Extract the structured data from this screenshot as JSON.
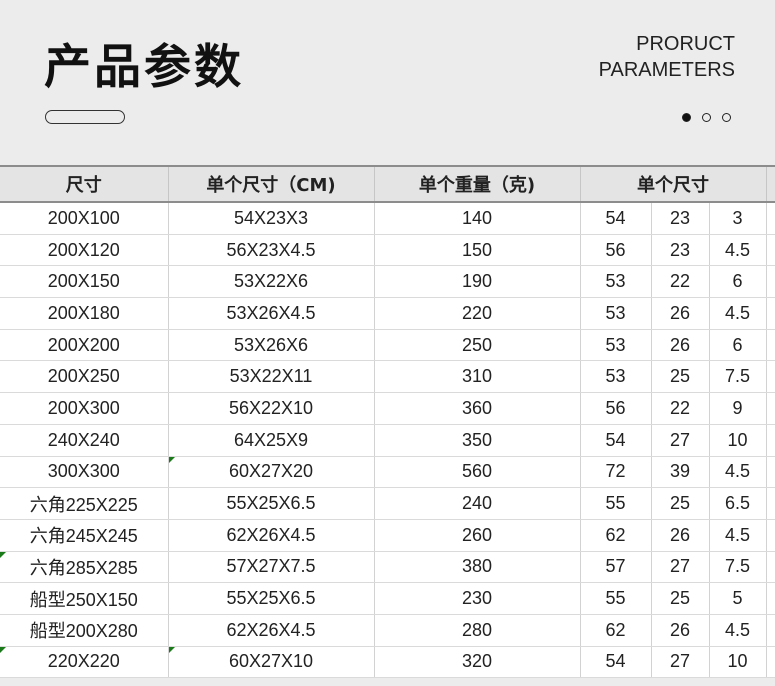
{
  "header": {
    "title": "产品参数",
    "subtitle_line1": "PRORUCT",
    "subtitle_line2": "PARAMETERS"
  },
  "table": {
    "headers": [
      "尺寸",
      "单个尺寸（CM)",
      "单个重量（克)",
      "单个尺寸"
    ],
    "rows": [
      [
        "200X100",
        "54X23X3",
        "140",
        "54",
        "23",
        "3"
      ],
      [
        "200X120",
        "56X23X4.5",
        "150",
        "56",
        "23",
        "4.5"
      ],
      [
        "200X150",
        "53X22X6",
        "190",
        "53",
        "22",
        "6"
      ],
      [
        "200X180",
        "53X26X4.5",
        "220",
        "53",
        "26",
        "4.5"
      ],
      [
        "200X200",
        "53X26X6",
        "250",
        "53",
        "26",
        "6"
      ],
      [
        "200X250",
        "53X22X11",
        "310",
        "53",
        "25",
        "7.5"
      ],
      [
        "200X300",
        "56X22X10",
        "360",
        "56",
        "22",
        "9"
      ],
      [
        "240X240",
        "64X25X9",
        "350",
        "54",
        "27",
        "10"
      ],
      [
        "300X300",
        "60X27X20",
        "560",
        "72",
        "39",
        "4.5"
      ],
      [
        "六角225X225",
        "55X25X6.5",
        "240",
        "55",
        "25",
        "6.5"
      ],
      [
        "六角245X245",
        "62X26X4.5",
        "260",
        "62",
        "26",
        "4.5"
      ],
      [
        "六角285X285",
        "57X27X7.5",
        "380",
        "57",
        "27",
        "7.5"
      ],
      [
        "船型250X150",
        "55X25X6.5",
        "230",
        "55",
        "25",
        "5"
      ],
      [
        "船型200X280",
        "62X26X4.5",
        "280",
        "62",
        "26",
        "4.5"
      ],
      [
        "220X220",
        "60X27X10",
        "320",
        "54",
        "27",
        "10"
      ]
    ]
  }
}
